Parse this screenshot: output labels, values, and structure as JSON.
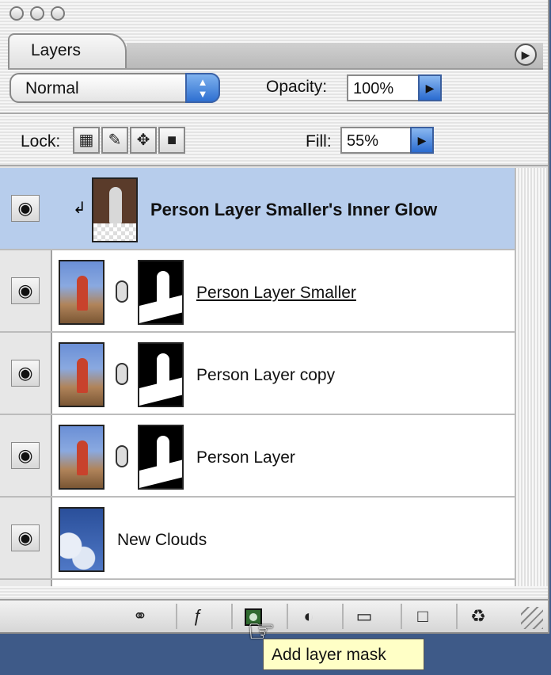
{
  "window": {
    "tab_label": "Layers"
  },
  "blending": {
    "mode": "Normal",
    "opacity_label": "Opacity:",
    "opacity_value": "100%",
    "lock_label": "Lock:",
    "fill_label": "Fill:",
    "fill_value": "55%"
  },
  "layers": [
    {
      "name": "Person Layer Smaller's Inner Glow",
      "selected": true,
      "clipped": true
    },
    {
      "name": "Person Layer Smaller",
      "underlined": true
    },
    {
      "name": "Person Layer copy"
    },
    {
      "name": "Person Layer"
    },
    {
      "name": "New Clouds"
    }
  ],
  "tooltip": "Add layer mask",
  "icons": {
    "eye": "eye-icon",
    "chain": "link-icon",
    "layer_style": "fx-icon",
    "add_mask": "add-layer-mask-icon",
    "adjustment": "half-circle-icon",
    "folder": "folder-icon",
    "new_layer": "new-layer-icon",
    "trash": "trash-icon"
  }
}
